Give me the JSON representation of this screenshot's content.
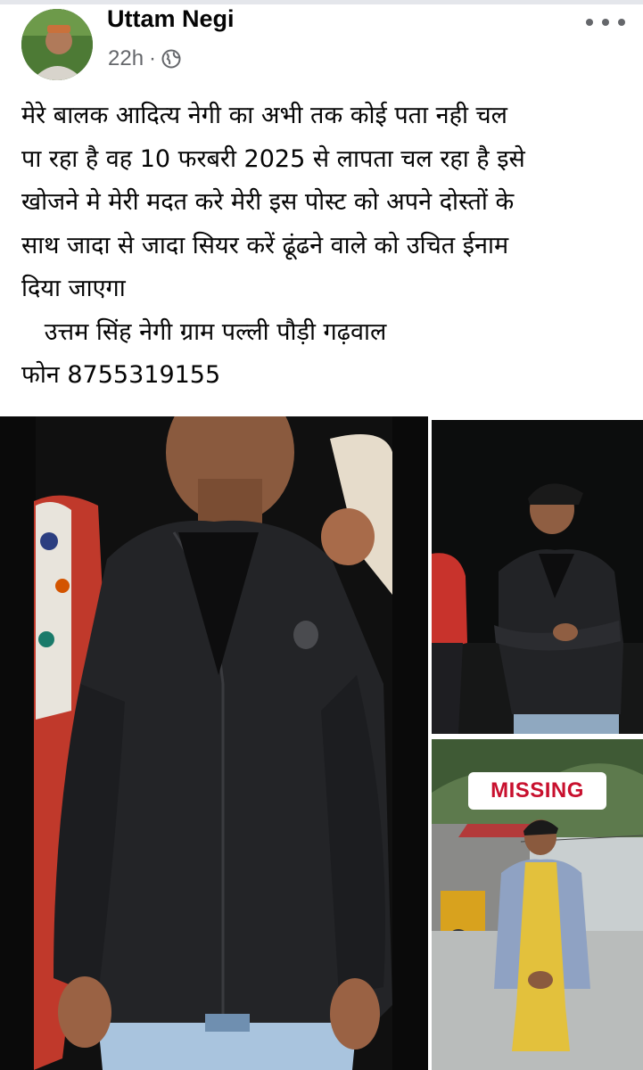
{
  "post": {
    "author": "Uttam Negi",
    "time": "22h",
    "separator": "·",
    "privacy_icon": "globe-icon",
    "more_icon": "more-dots-icon",
    "lines": [
      "मेरे बालक आदित्य नेगी का अभी तक कोई पता नही चल",
      "पा रहा है वह 10 फरबरी 2025 से लापता चल रहा है इसे",
      "खोजने मे मेरी मदत करे मेरी इस पोस्ट को  अपने दोस्तों के",
      "साथ जादा से जादा सियर करें ढूंढने वाले को उचित ईनाम",
      "दिया जाएगा",
      "   उत्तम सिंह नेगी ग्राम पल्ली पौड़ी गढ़वाल",
      "फोन 8755319155"
    ]
  },
  "photos": {
    "missing_label": "MISSING"
  }
}
